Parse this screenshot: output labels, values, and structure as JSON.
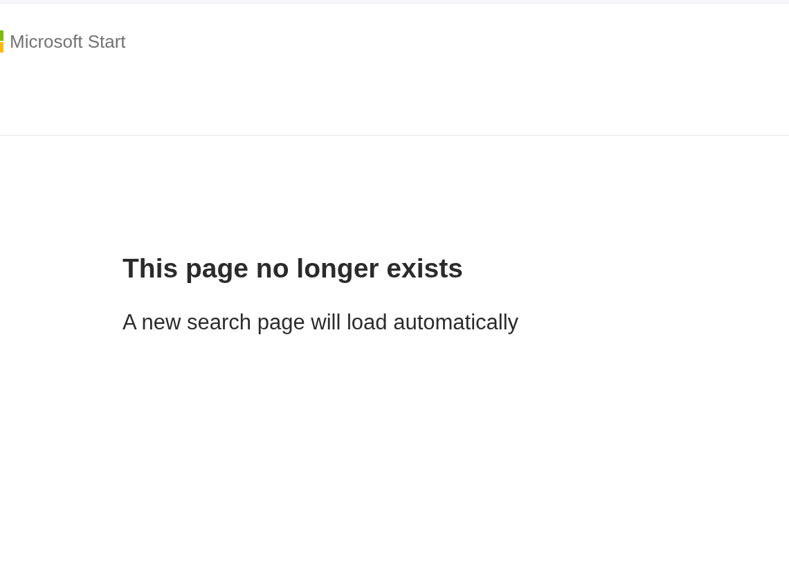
{
  "header": {
    "logo": {
      "text": "Microsoft Start"
    }
  },
  "message": {
    "title": "This page no longer exists",
    "subtitle": "A new search page will load automatically"
  }
}
